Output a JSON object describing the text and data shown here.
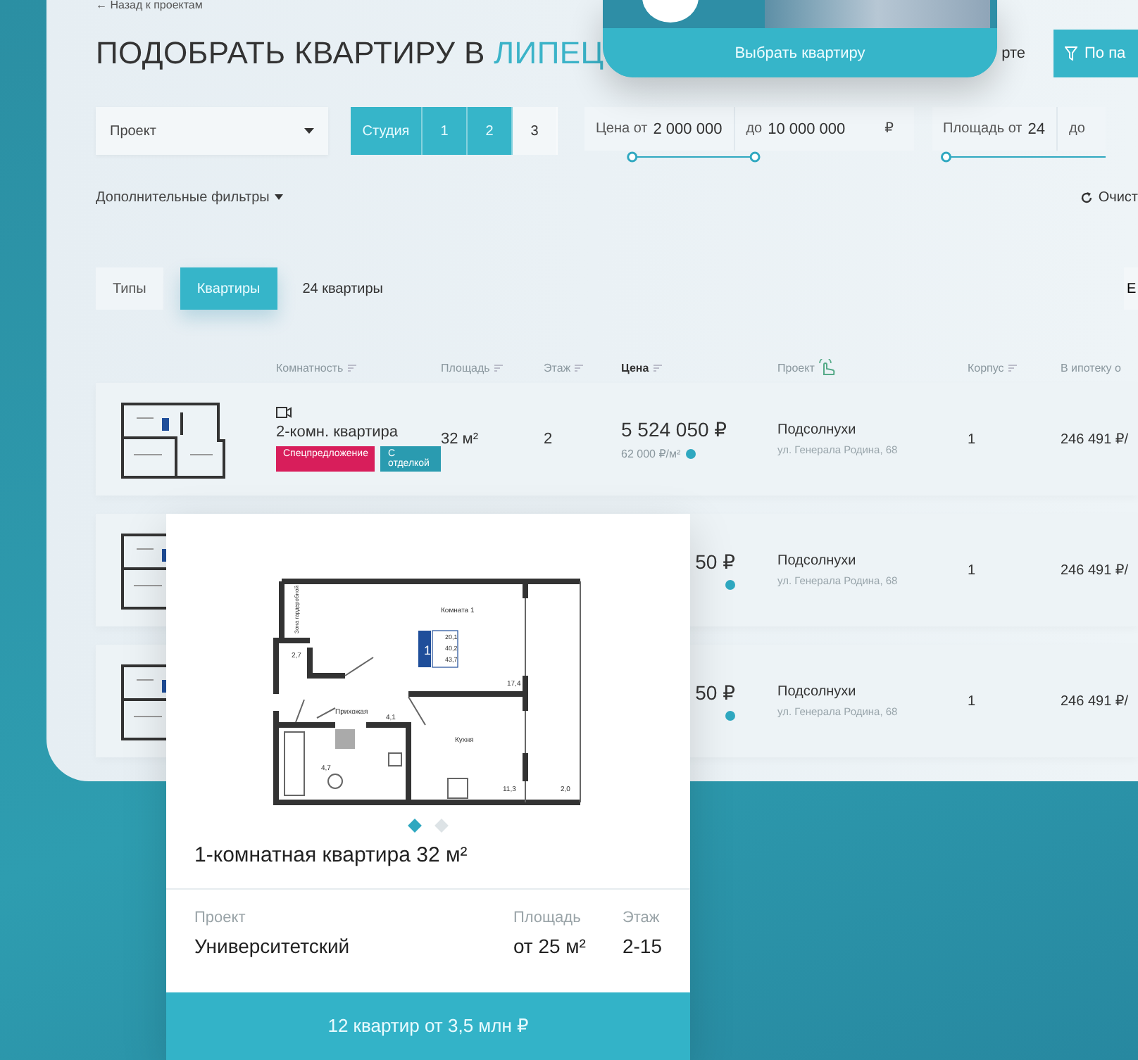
{
  "back_link": "← Назад к проектам",
  "title": "ПОДОБРАТЬ КВАРТИРУ В ",
  "title_city": "ЛИПЕЦ",
  "map_link": "рте",
  "params_button": "По па",
  "promo_card": {
    "button": "Выбрать квартиру"
  },
  "filters": {
    "project": "Проект",
    "rooms": [
      {
        "label": "Студия",
        "selected": true
      },
      {
        "label": "1",
        "selected": true
      },
      {
        "label": "2",
        "selected": true
      },
      {
        "label": "3",
        "selected": false
      }
    ],
    "price_from_label": "Цена от",
    "price_from": "2 000 000",
    "price_to_label": "до",
    "price_to": "10 000 000",
    "currency": "₽",
    "price_slider": [
      {
        "level": 0.12
      },
      {
        "level": 0.47
      }
    ],
    "area_from_label": "Площадь от",
    "area_from": "24",
    "area_to_label": "до",
    "area_slider": [
      {
        "level": 0.05
      }
    ],
    "more_filters": "Дополнительные фильтры",
    "clear": "Очист"
  },
  "tabs": [
    {
      "label": "Типы",
      "selected": false
    },
    {
      "label": "Квартиры",
      "selected": true
    }
  ],
  "count": "24 квартиры",
  "view_button": "Е",
  "columns": [
    "Комнатность",
    "Площадь",
    "Этаж",
    "Цена",
    "Проект",
    "Корпус",
    "В ипотеку о"
  ],
  "rows": [
    {
      "name": "2-комн. квартира",
      "area": "32 м²",
      "floor": "2",
      "price": "5 524 050 ₽",
      "price_per_m": "62 000 ₽/м²",
      "tags": [
        {
          "label": "Спецпредложение",
          "color": "#d81e5b"
        },
        {
          "label": "С отделкой",
          "color": "#2a9bb0"
        }
      ],
      "project": "Подсолнухи",
      "address": "ул. Генерала Родина, 68",
      "building": "1",
      "mortgage": "246 491 ₽/"
    },
    {
      "price": "50 ₽",
      "project": "Подсолнухи",
      "address": "ул. Генерала Родина, 68",
      "building": "1",
      "mortgage": "246 491 ₽/"
    },
    {
      "price": "50 ₽",
      "project": "Подсолнухи",
      "address": "ул. Генерала Родина, 68",
      "building": "1",
      "mortgage": "246 491 ₽/"
    }
  ],
  "layout_card": {
    "plan_labels": [
      "Комната 1",
      "Зона гардеробной",
      "2,7",
      "1",
      "20,1",
      "40,2",
      "43,7",
      "17,4",
      "Прихожая",
      "4,1",
      "Кухня",
      "4,7",
      "11,3",
      "2,0"
    ],
    "slides": [
      {
        "selected": true
      },
      {
        "selected": false
      }
    ],
    "title": "1-комнатная квартира 32 м²",
    "fields": [
      {
        "label": "Проект",
        "value": "Университетский"
      },
      {
        "label": "Площадь",
        "value": "от 25 м²"
      },
      {
        "label": "Этаж",
        "value": "2-15"
      }
    ],
    "footer": "12 квартир от 3,5 млн ₽"
  }
}
